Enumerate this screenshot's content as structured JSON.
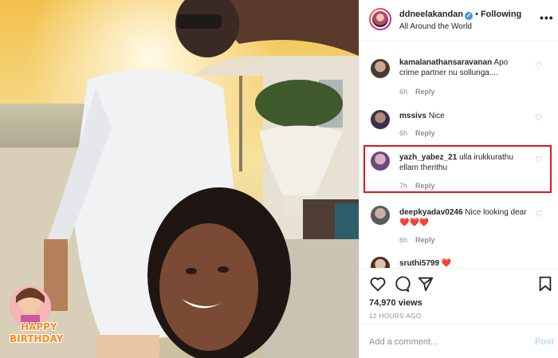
{
  "post": {
    "username": "ddneelakandan",
    "verified_mark": "✓",
    "separator": "•",
    "follow_label": "Following",
    "location": "All Around the World",
    "more_label": "•••"
  },
  "sticker": {
    "line1": "HAPPY",
    "line2": "BIRTHDAY"
  },
  "comments": [
    {
      "user": "kamalanathansaravanan",
      "text": "Apo crime partner nu sollunga....",
      "age": "6h",
      "reply": "Reply"
    },
    {
      "user": "mssivs",
      "text": "Nice",
      "age": "6h",
      "reply": "Reply"
    },
    {
      "user": "yazh_yabez_21",
      "text": "ulla irukkurathu ellam therithu",
      "age": "7h",
      "reply": "Reply"
    },
    {
      "user": "deepkyadav0246",
      "text": "Nice looking dear❤️❤️❤️",
      "age": "6h",
      "reply": "Reply"
    },
    {
      "user": "sruthi5799",
      "text": "❤️",
      "age": "",
      "reply": ""
    }
  ],
  "stats": {
    "views": "74,970 views",
    "time": "12 HOURS AGO"
  },
  "composer": {
    "placeholder": "Add a comment...",
    "post_label": "Post"
  },
  "colors": {
    "highlight": "#e0161b",
    "link": "#3897f0"
  }
}
